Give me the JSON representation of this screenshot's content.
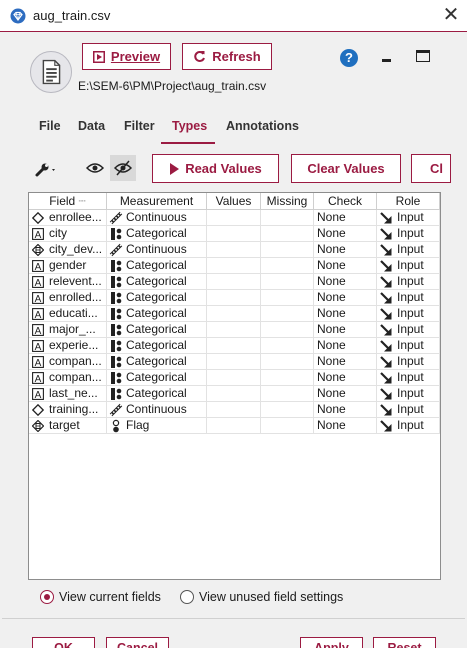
{
  "window": {
    "title": "aug_train.csv"
  },
  "header": {
    "preview_label": "Preview",
    "refresh_label": "Refresh",
    "file_path": "E:\\SEM-6\\PM\\Project\\aug_train.csv",
    "help_glyph": "?"
  },
  "tabs": [
    {
      "label": "File"
    },
    {
      "label": "Data"
    },
    {
      "label": "Filter"
    },
    {
      "label": "Types",
      "active": true
    },
    {
      "label": "Annotations"
    }
  ],
  "toolbar": {
    "read_values_label": "Read Values",
    "clear_values_label": "Clear Values",
    "truncated_button_label": "Cl"
  },
  "table": {
    "columns": [
      "Field",
      "Measurement",
      "Values",
      "Missing",
      "Check",
      "Role"
    ],
    "rows": [
      {
        "field": "enrollee...",
        "type_icon": "continuous-diamond-icon",
        "measurement": "Continuous",
        "values": "",
        "missing": "",
        "check": "None",
        "role": "Input"
      },
      {
        "field": "city",
        "type_icon": "string-a-icon",
        "measurement": "Categorical",
        "values": "",
        "missing": "",
        "check": "None",
        "role": "Input"
      },
      {
        "field": "city_dev...",
        "type_icon": "real-number-icon",
        "measurement": "Continuous",
        "values": "",
        "missing": "",
        "check": "None",
        "role": "Input"
      },
      {
        "field": "gender",
        "type_icon": "string-a-icon",
        "measurement": "Categorical",
        "values": "",
        "missing": "",
        "check": "None",
        "role": "Input"
      },
      {
        "field": "relevent...",
        "type_icon": "string-a-icon",
        "measurement": "Categorical",
        "values": "",
        "missing": "",
        "check": "None",
        "role": "Input"
      },
      {
        "field": "enrolled...",
        "type_icon": "string-a-icon",
        "measurement": "Categorical",
        "values": "",
        "missing": "",
        "check": "None",
        "role": "Input"
      },
      {
        "field": "educati...",
        "type_icon": "string-a-icon",
        "measurement": "Categorical",
        "values": "",
        "missing": "",
        "check": "None",
        "role": "Input"
      },
      {
        "field": "major_...",
        "type_icon": "string-a-icon",
        "measurement": "Categorical",
        "values": "",
        "missing": "",
        "check": "None",
        "role": "Input"
      },
      {
        "field": "experie...",
        "type_icon": "string-a-icon",
        "measurement": "Categorical",
        "values": "",
        "missing": "",
        "check": "None",
        "role": "Input"
      },
      {
        "field": "compan...",
        "type_icon": "string-a-icon",
        "measurement": "Categorical",
        "values": "",
        "missing": "",
        "check": "None",
        "role": "Input"
      },
      {
        "field": "compan...",
        "type_icon": "string-a-icon",
        "measurement": "Categorical",
        "values": "",
        "missing": "",
        "check": "None",
        "role": "Input"
      },
      {
        "field": "last_ne...",
        "type_icon": "string-a-icon",
        "measurement": "Categorical",
        "values": "",
        "missing": "",
        "check": "None",
        "role": "Input"
      },
      {
        "field": "training...",
        "type_icon": "continuous-diamond-icon",
        "measurement": "Continuous",
        "values": "",
        "missing": "",
        "check": "None",
        "role": "Input"
      },
      {
        "field": "target",
        "type_icon": "real-number-icon",
        "measurement": "Flag",
        "values": "",
        "missing": "",
        "check": "None",
        "role": "Input"
      }
    ]
  },
  "view_options": {
    "current_fields_label": "View current fields",
    "unused_settings_label": "View unused field settings",
    "selected": "current"
  },
  "footer": {
    "ok_label": "OK",
    "cancel_label": "Cancel",
    "apply_label": "Apply",
    "reset_label": "Reset"
  },
  "colors": {
    "accent": "#9b1b42",
    "help_blue": "#1f6fbf"
  }
}
